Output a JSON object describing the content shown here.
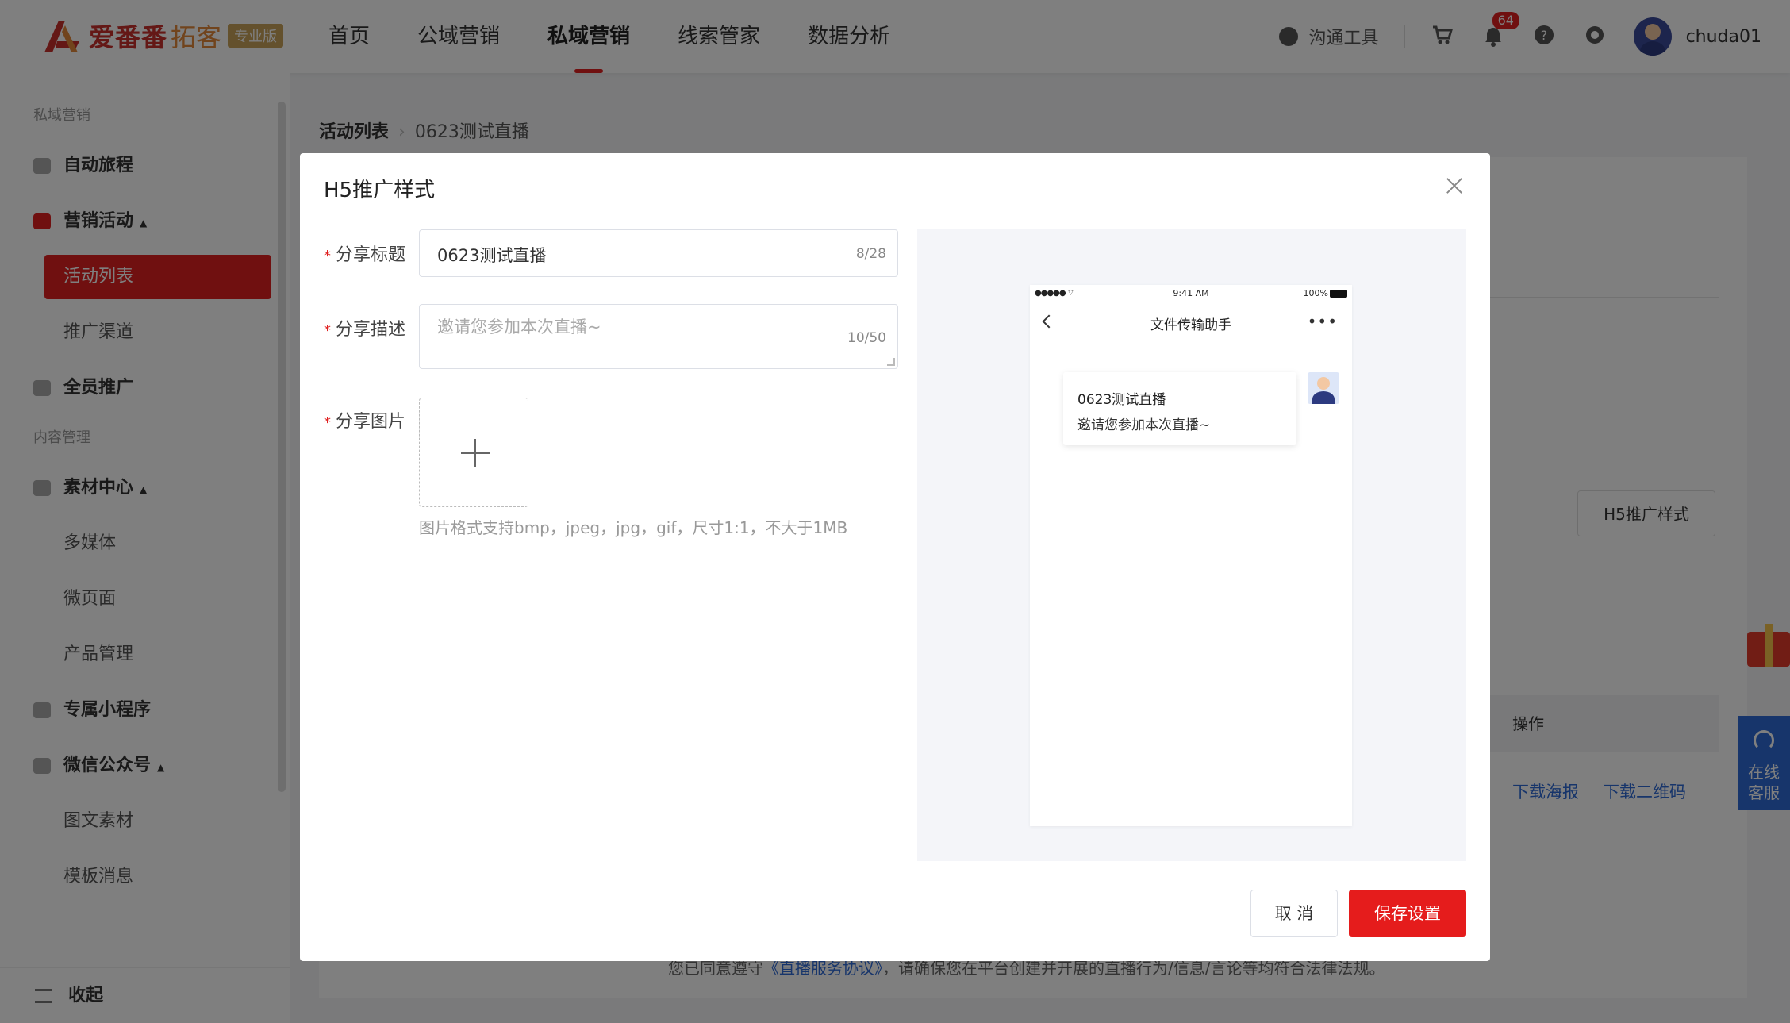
{
  "header": {
    "logo_text": "爱番番",
    "logo_text2": "拓客",
    "logo_badge": "专业版",
    "nav": [
      "首页",
      "公域营销",
      "私域营销",
      "线索管家",
      "数据分析"
    ],
    "active_nav_index": 2,
    "chat_tool_label": "沟通工具",
    "notification_count": "64",
    "username": "chuda01",
    "icons": [
      "chat-icon",
      "cart-icon",
      "bell-icon",
      "help-icon",
      "settings-icon"
    ]
  },
  "sidebar": {
    "group1": "私域营销",
    "items1": [
      {
        "label": "自动旅程"
      },
      {
        "label": "营销活动"
      },
      {
        "label": "活动列表"
      },
      {
        "label": "推广渠道"
      },
      {
        "label": "全员推广"
      }
    ],
    "group2": "内容管理",
    "items2": [
      {
        "label": "素材中心"
      },
      {
        "label": "多媒体"
      },
      {
        "label": "微页面"
      },
      {
        "label": "产品管理"
      },
      {
        "label": "专属小程序"
      },
      {
        "label": "微信公众号"
      },
      {
        "label": "图文素材"
      },
      {
        "label": "模板消息"
      }
    ],
    "collapse_label": "收起"
  },
  "content": {
    "breadcrumb_root": "活动列表",
    "breadcrumb_current": "0623测试直播",
    "h5_button": "H5推广样式",
    "table_header_action": "操作",
    "link_poster": "下载海报",
    "link_qrcode": "下载二维码",
    "notice_prefix": "您已同意遵守",
    "notice_link": "《直播服务协议》",
    "notice_suffix": "，请确保您在平台创建并开展的直播行为/信息/言论等均符合法律法规。"
  },
  "floating": {
    "service_line1": "在线",
    "service_line2": "客服"
  },
  "dialog": {
    "title": "H5推广样式",
    "share_title_label": "分享标题",
    "share_title_value": "0623测试直播",
    "share_title_count": "8/28",
    "share_desc_label": "分享描述",
    "share_desc_placeholder": "邀请您参加本次直播~",
    "share_desc_count": "10/50",
    "share_image_label": "分享图片",
    "image_hint": "图片格式支持bmp，jpeg，jpg，gif，尺寸1:1，不大于1MB",
    "cancel_label": "取 消",
    "save_label": "保存设置",
    "preview": {
      "time": "9:41 AM",
      "battery": "100%",
      "chat_title": "文件传输助手",
      "card_title": "0623测试直播",
      "card_desc": "邀请您参加本次直播~"
    }
  },
  "colors": {
    "accent": "#e02020",
    "link": "#2f6bd6"
  }
}
